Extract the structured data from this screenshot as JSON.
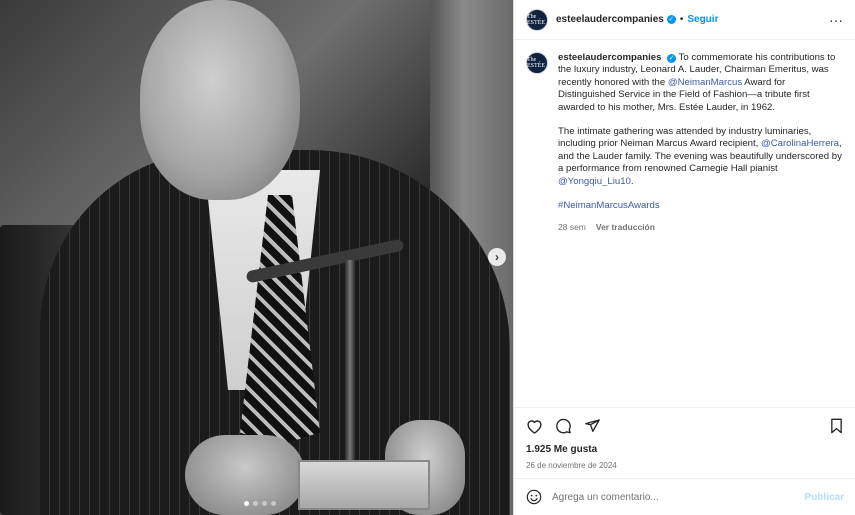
{
  "post": {
    "username": "esteelaudercompanies",
    "avatar_text": "The ESTÉE",
    "verified_icon": "verified-badge-icon",
    "separator": "•",
    "follow_label": "Seguir",
    "more_label": "···"
  },
  "caption": {
    "username": "esteelaudercompanies",
    "p1_a": "To commemorate his contributions to the luxury industry, Leonard A. Lauder, Chairman Emeritus, was recently honored with the ",
    "p1_link": "@NeimanMarcus",
    "p1_b": " Award for Distinguished Service in the Field of Fashion—a tribute first awarded to his mother, Mrs. Estée Lauder, in 1962.",
    "p2_a": "The intimate gathering was attended by industry luminaries, including prior Neiman Marcus Award recipient, ",
    "p2_link1": "@CarolinaHerrera",
    "p2_b": ", and the Lauder family. The evening was beautifully underscored by a performance from renowned Carnegie Hall pianist ",
    "p2_link2": "@Yongqiu_Liu10",
    "p2_c": ".",
    "hashtag": "#NeimanMarcusAwards",
    "age": "28 sem",
    "translate": "Ver traducción"
  },
  "actions": {
    "icons": [
      "heart-icon",
      "comment-icon",
      "share-icon",
      "bookmark-icon"
    ],
    "likes": "1.925 Me gusta",
    "date": "26 de noviembre de 2024"
  },
  "comment": {
    "placeholder": "Agrega un comentario...",
    "publish_label": "Publicar"
  },
  "media": {
    "carousel_total": 4,
    "carousel_active": 1
  },
  "colors": {
    "accent": "#0095f6",
    "link": "#3d5aa8",
    "muted": "#737373",
    "publish_disabled": "#b2dffc"
  }
}
